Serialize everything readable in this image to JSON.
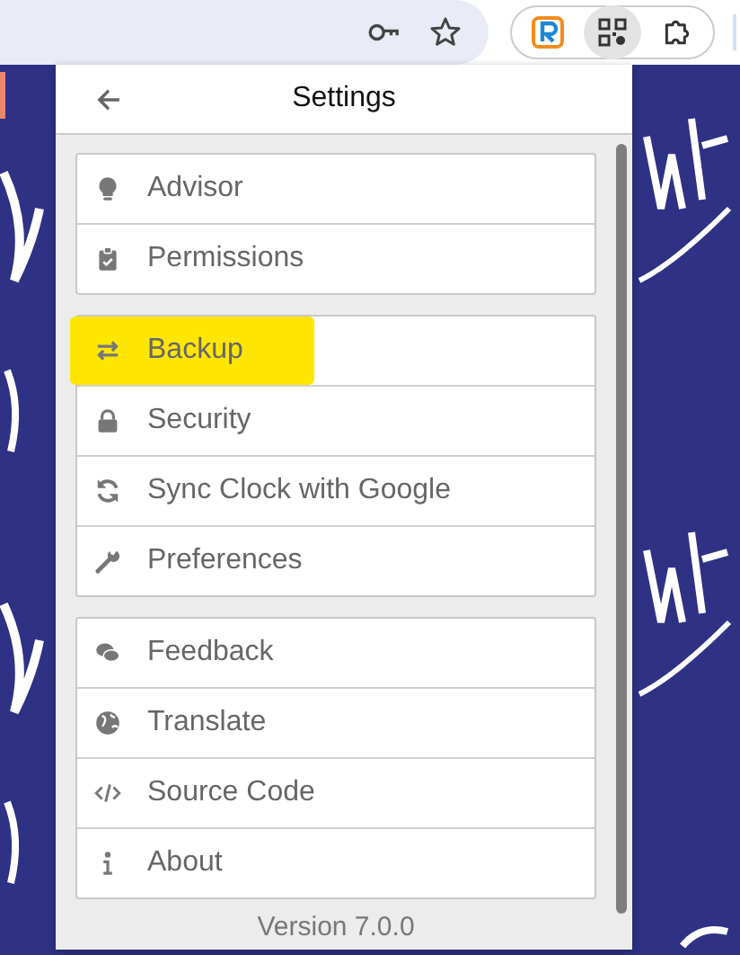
{
  "popup": {
    "title": "Settings",
    "groups": [
      {
        "items": [
          {
            "label": "Advisor",
            "highlighted": false
          },
          {
            "label": "Permissions",
            "highlighted": false
          }
        ]
      },
      {
        "items": [
          {
            "label": "Backup",
            "highlighted": true
          },
          {
            "label": "Security",
            "highlighted": false
          },
          {
            "label": "Sync Clock with Google",
            "highlighted": false
          },
          {
            "label": "Preferences",
            "highlighted": false
          }
        ]
      },
      {
        "items": [
          {
            "label": "Feedback",
            "highlighted": false
          },
          {
            "label": "Translate",
            "highlighted": false
          },
          {
            "label": "Source Code",
            "highlighted": false
          },
          {
            "label": "About",
            "highlighted": false
          }
        ]
      }
    ],
    "version": "Version 7.0.0"
  }
}
